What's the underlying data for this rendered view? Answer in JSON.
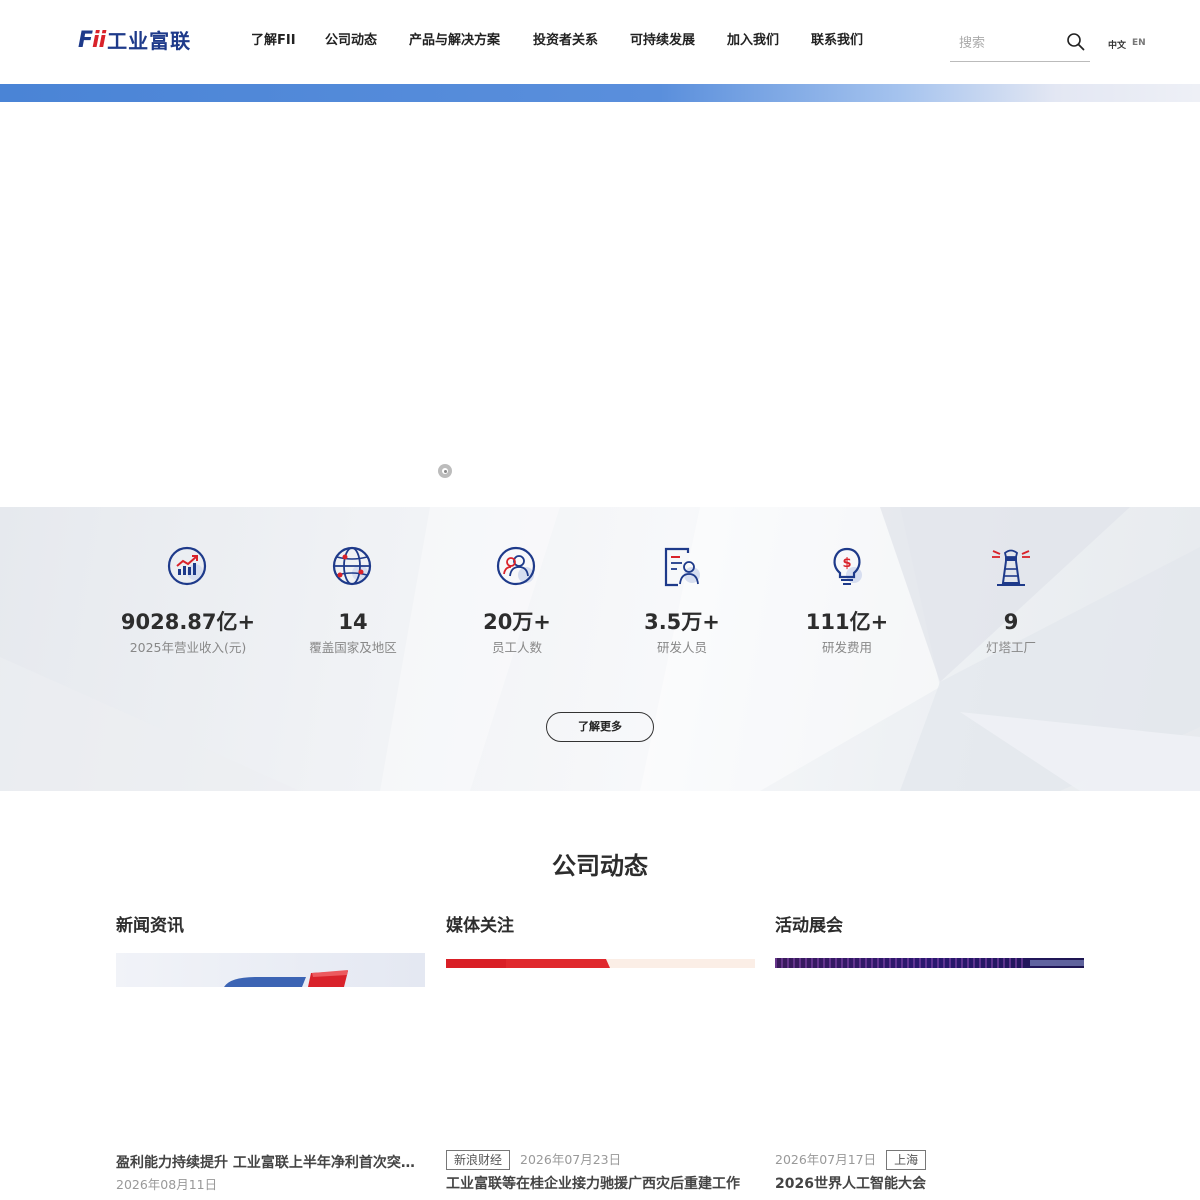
{
  "header": {
    "logo_mark_f": "F",
    "logo_mark_ii": "ii",
    "logo_text": "工业富联",
    "nav": [
      "了解FII",
      "公司动态",
      "产品与解决方案",
      "投资者关系",
      "可持续发展",
      "加入我们",
      "联系我们"
    ],
    "search_placeholder": "搜索",
    "lang_zh": "中文",
    "lang_en": "EN"
  },
  "colors": {
    "brand_blue": "#1e3a8a",
    "brand_red": "#d9222a",
    "accent_blue": "#4a84d6"
  },
  "stats": [
    {
      "icon": "growth-chart-icon",
      "value": "9028.87亿+",
      "label": "2025年营业收入(元)"
    },
    {
      "icon": "globe-icon",
      "value": "14",
      "label": "覆盖国家及地区"
    },
    {
      "icon": "employees-icon",
      "value": "20万+",
      "label": "员工人数"
    },
    {
      "icon": "researcher-icon",
      "value": "3.5万+",
      "label": "研发人员"
    },
    {
      "icon": "lightbulb-dollar-icon",
      "value": "111亿+",
      "label": "研发费用"
    },
    {
      "icon": "lighthouse-icon",
      "value": "9",
      "label": "灯塔工厂"
    }
  ],
  "more_button": "了解更多",
  "news_section": {
    "title": "公司动态",
    "columns": [
      {
        "heading": "新闻资讯",
        "tag": "",
        "date": "2026年08月11日",
        "headline": "盈利能力持续提升 工业富联上半年净利首次突破百亿元"
      },
      {
        "heading": "媒体关注",
        "tag": "新浪财经",
        "date": "2026年07月23日",
        "headline": "工业富联等在桂企业接力驰援广西灾后重建工作"
      },
      {
        "heading": "活动展会",
        "tag": "上海",
        "date": "2026年07月17日",
        "headline": "2026世界人工智能大会"
      }
    ]
  }
}
